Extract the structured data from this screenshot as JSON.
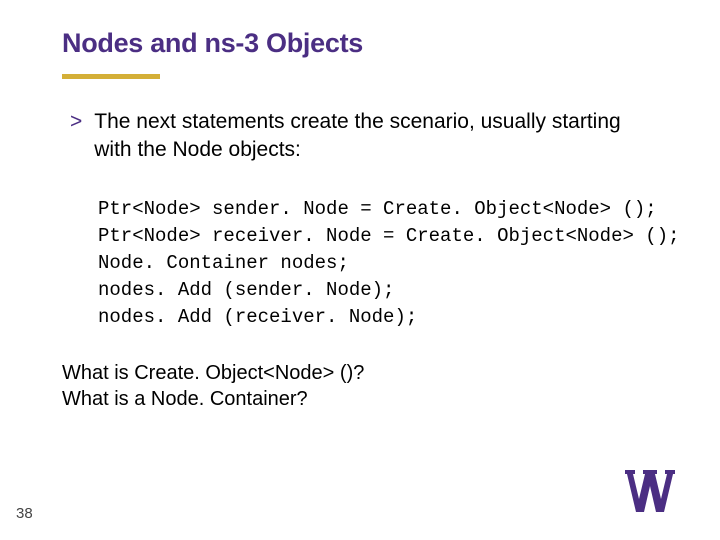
{
  "title": "Nodes and ns-3 Objects",
  "bullet": {
    "marker": ">",
    "text": "The next statements create the scenario, usually starting\nwith the Node objects:"
  },
  "code": "Ptr<Node> sender. Node = Create. Object<Node> ();\nPtr<Node> receiver. Node = Create. Object<Node> ();\nNode. Container nodes;\nnodes. Add (sender. Node);\nnodes. Add (receiver. Node);",
  "questions": "What is Create. Object<Node> ()?\nWhat is a Node. Container?",
  "page_number": "38",
  "brand_color": "#4b2e83"
}
